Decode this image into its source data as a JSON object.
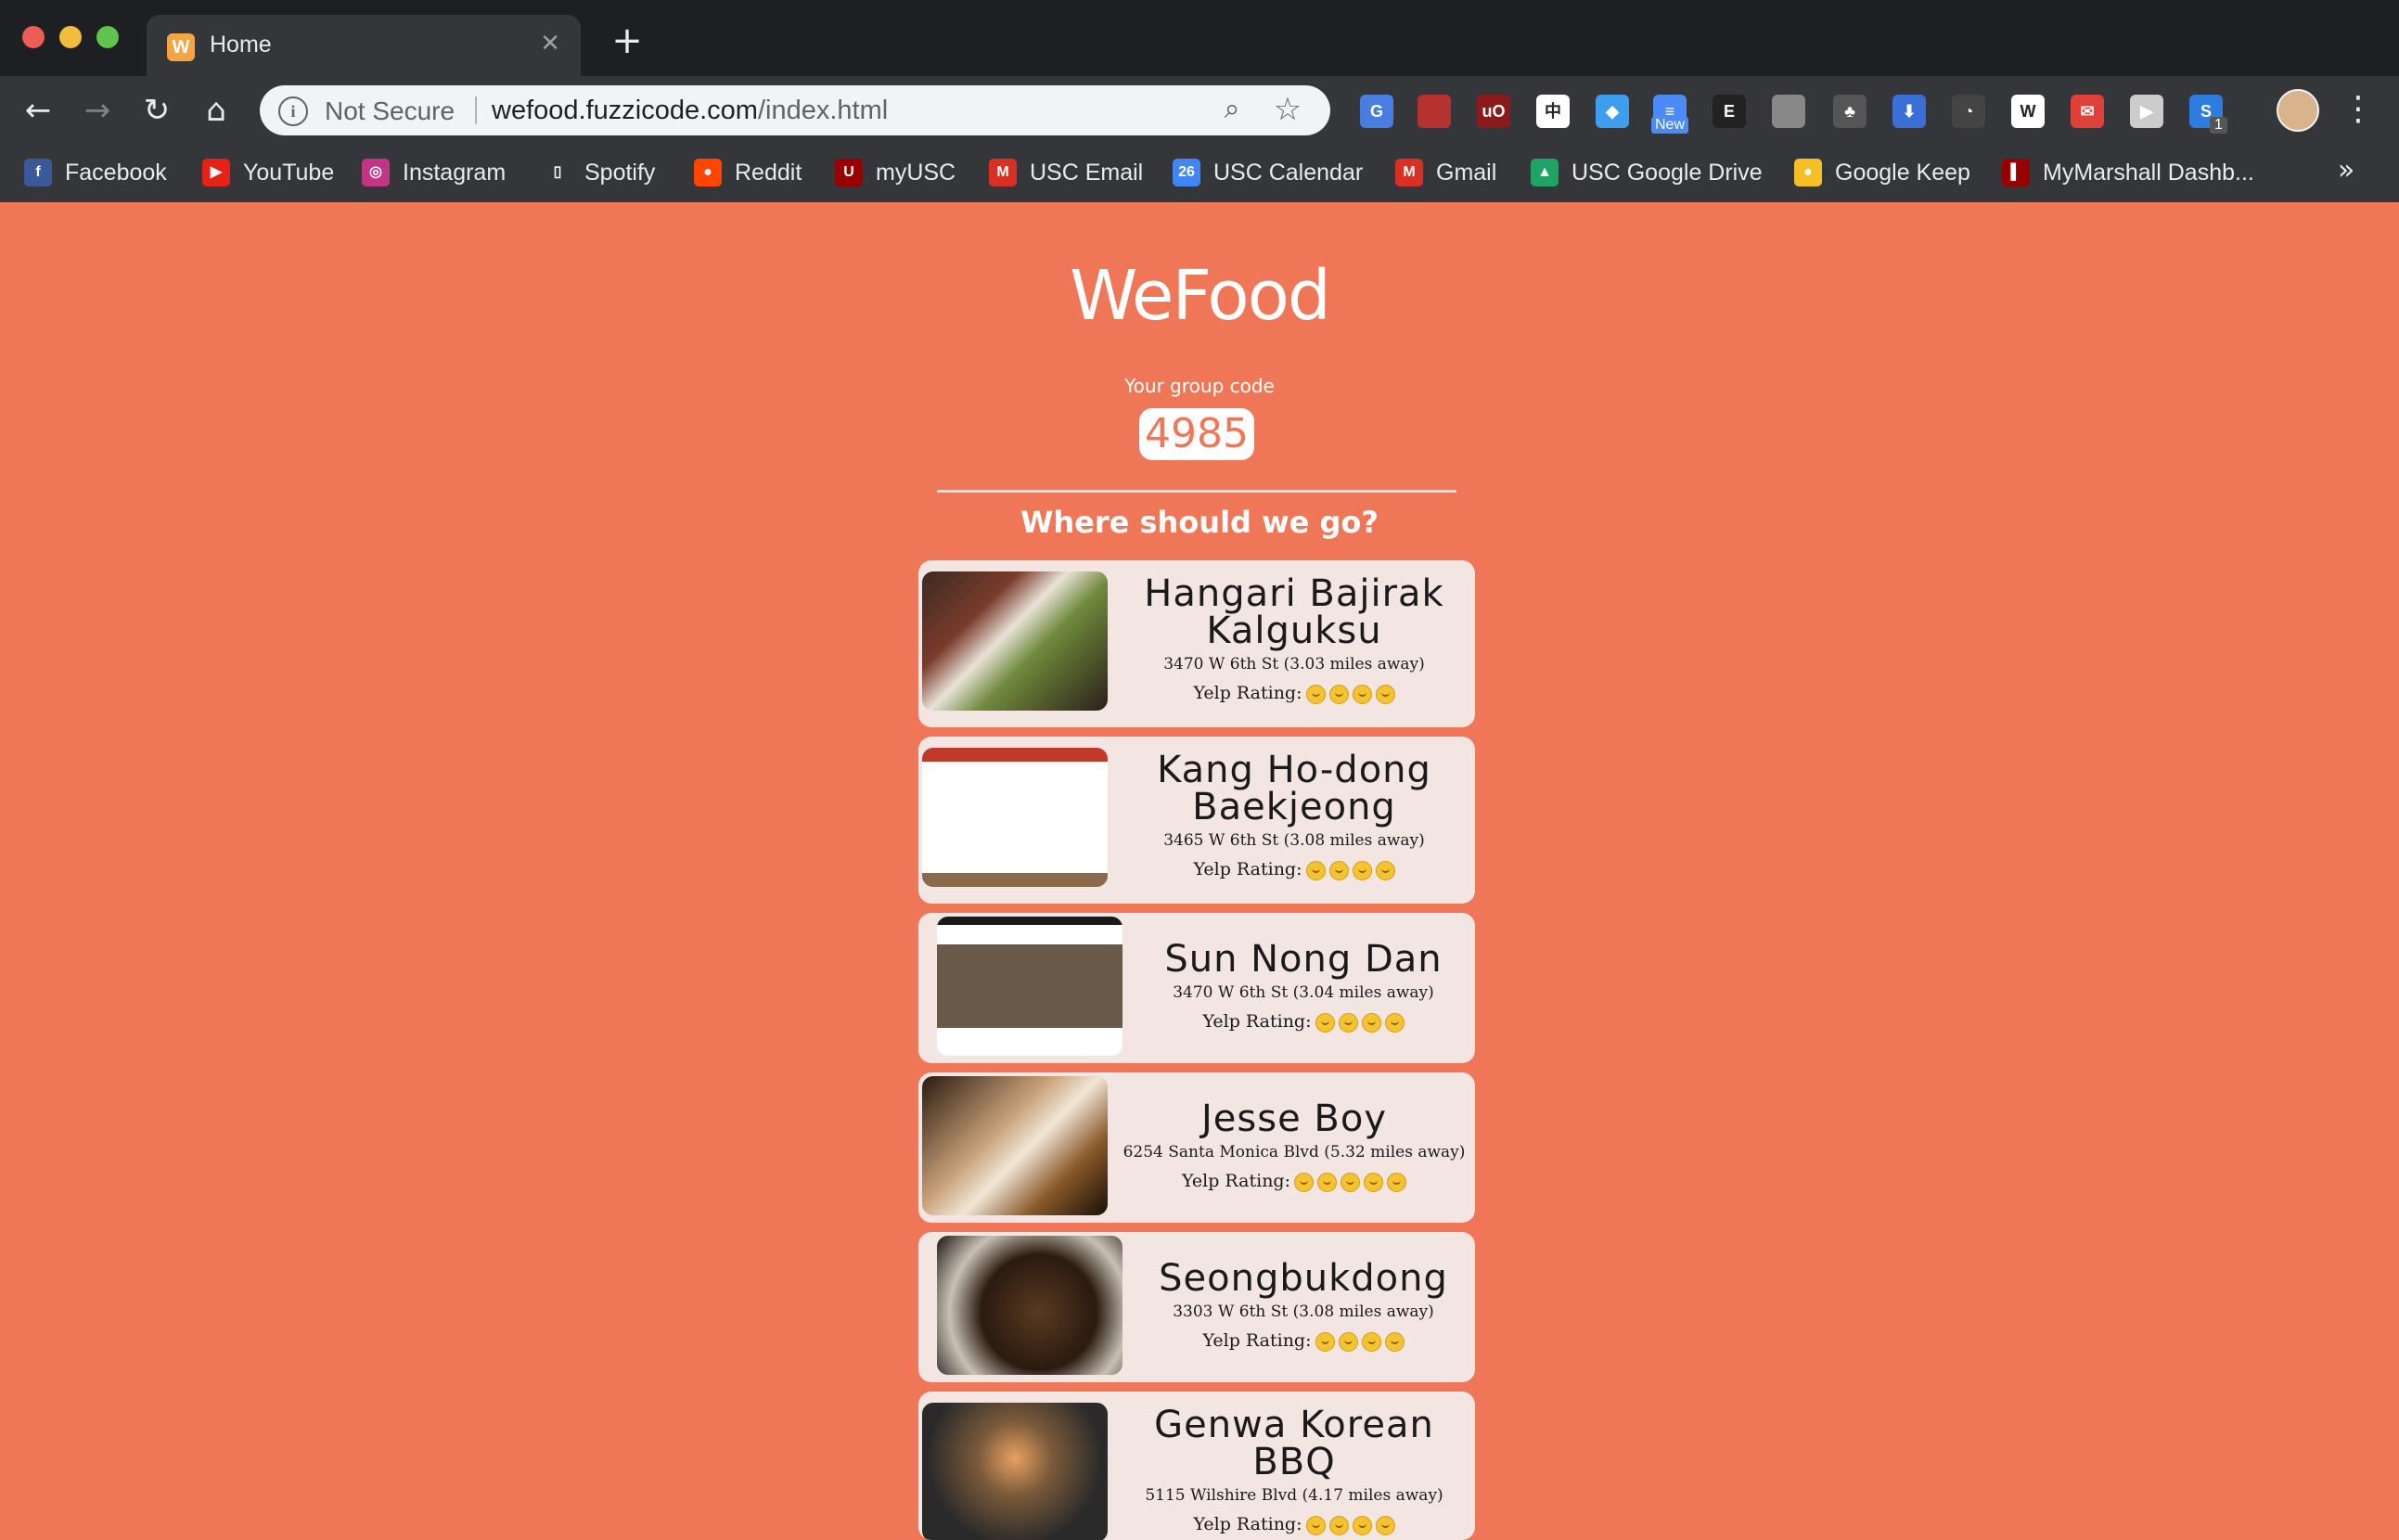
{
  "browser": {
    "tab_title": "Home",
    "tab_favicon_letter": "W",
    "omnibox": {
      "security_label": "Not Secure",
      "url_host": "wefood.fuzzicode.com",
      "url_path": "/index.html"
    },
    "extensions": [
      {
        "name": "translate-icon",
        "color": "#4a7de0",
        "glyph": "G"
      },
      {
        "name": "book-icon",
        "color": "#b5322f",
        "glyph": ""
      },
      {
        "name": "ublock-icon",
        "color": "#8b1a1a",
        "glyph": "uO"
      },
      {
        "name": "kanji-icon",
        "color": "#ffffff",
        "glyph": "中"
      },
      {
        "name": "gem-icon",
        "color": "#3d9ef0",
        "glyph": "◆"
      },
      {
        "name": "new-tab-extension-icon",
        "color": "#4c8bf5",
        "glyph": "≡"
      },
      {
        "name": "e-extension-icon",
        "color": "#222222",
        "glyph": "E"
      },
      {
        "name": "image-extension-icon",
        "color": "#888888",
        "glyph": ""
      },
      {
        "name": "tree-icon",
        "color": "#555555",
        "glyph": "♣"
      },
      {
        "name": "download-icon",
        "color": "#3b6fd8",
        "glyph": "⬇"
      },
      {
        "name": "speedometer-icon",
        "color": "#444444",
        "glyph": "◔"
      },
      {
        "name": "wikipedia-icon",
        "color": "#ffffff",
        "glyph": "W"
      },
      {
        "name": "gift-icon",
        "color": "#e0403a",
        "glyph": "✉"
      },
      {
        "name": "video-icon",
        "color": "#cccccc",
        "glyph": "▶"
      },
      {
        "name": "s-extension-icon",
        "color": "#2d7de0",
        "glyph": "S"
      }
    ],
    "extension_new_badge": "New",
    "extension_count_badge": "1",
    "bookmarks": [
      {
        "label": "Facebook",
        "icon": "facebook-icon",
        "color": "#3b5998",
        "glyph": "f"
      },
      {
        "label": "YouTube",
        "icon": "youtube-icon",
        "color": "#e62117",
        "glyph": "▶"
      },
      {
        "label": "Instagram",
        "icon": "instagram-icon",
        "color": "#c13584",
        "glyph": "◎"
      },
      {
        "label": "Spotify",
        "icon": "page-icon",
        "color": "#35363a",
        "glyph": "▯"
      },
      {
        "label": "Reddit",
        "icon": "reddit-icon",
        "color": "#ff4500",
        "glyph": "●"
      },
      {
        "label": "myUSC",
        "icon": "usc-icon",
        "color": "#990000",
        "glyph": "U"
      },
      {
        "label": "USC Email",
        "icon": "gmail-icon",
        "color": "#d93025",
        "glyph": "M"
      },
      {
        "label": "USC Calendar",
        "icon": "calendar-icon",
        "color": "#4285f4",
        "glyph": "26"
      },
      {
        "label": "Gmail",
        "icon": "gmail-icon",
        "color": "#d93025",
        "glyph": "M"
      },
      {
        "label": "USC Google Drive",
        "icon": "drive-icon",
        "color": "#1fa463",
        "glyph": "▲"
      },
      {
        "label": "Google Keep",
        "icon": "keep-icon",
        "color": "#f6bf26",
        "glyph": "●"
      },
      {
        "label": "MyMarshall Dashb...",
        "icon": "marshall-icon",
        "color": "#990000",
        "glyph": "▌"
      }
    ],
    "bookmarks_overflow": "»"
  },
  "app": {
    "logo": "WeFood",
    "group_code_label": "Your group code",
    "group_code": "4985",
    "question": "Where should we go?",
    "rating_label": "Yelp Rating:",
    "restaurants": [
      {
        "name": "Hangari Bajirak Kalguksu",
        "address": "3470 W 6th St (3.03 miles away)",
        "rating": 4
      },
      {
        "name": "Kang Ho-dong Baekjeong",
        "address": "3465 W 6th St (3.08 miles away)",
        "rating": 4
      },
      {
        "name": "Sun Nong Dan",
        "address": "3470 W 6th St (3.04 miles away)",
        "rating": 4
      },
      {
        "name": "Jesse Boy",
        "address": "6254 Santa Monica Blvd (5.32 miles away)",
        "rating": 5
      },
      {
        "name": "Seongbukdong",
        "address": "3303 W 6th St (3.08 miles away)",
        "rating": 4
      },
      {
        "name": "Genwa Korean BBQ",
        "address": "5115 Wilshire Blvd (4.17 miles away)",
        "rating": 4
      }
    ]
  }
}
